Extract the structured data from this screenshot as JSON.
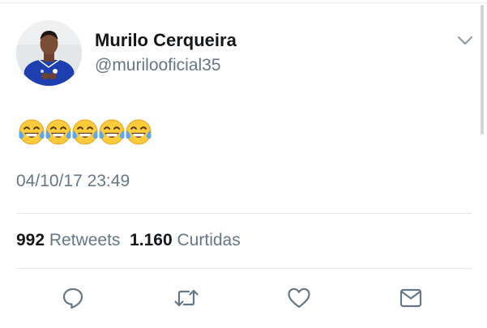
{
  "tweet": {
    "author": {
      "display_name": "Murilo Cerqueira",
      "handle": "@murilooficial35",
      "avatar_icon": "profile-photo"
    },
    "body": {
      "emoji_name": "face-with-tears-of-joy",
      "emoji_count": 5
    },
    "timestamp": "04/10/17 23:49",
    "stats": {
      "retweets_count": "992",
      "retweets_label": "Retweets",
      "likes_count": "1.160",
      "likes_label": "Curtidas"
    },
    "actions": [
      {
        "name": "reply",
        "icon": "reply-icon"
      },
      {
        "name": "retweet",
        "icon": "retweet-icon"
      },
      {
        "name": "like",
        "icon": "heart-icon"
      },
      {
        "name": "direct-message",
        "icon": "envelope-icon"
      }
    ],
    "menu_icon": "chevron-down-icon"
  },
  "colors": {
    "primary_text": "#14171a",
    "secondary_text": "#657786",
    "divider": "#e1e8ed",
    "icon": "#657786",
    "emoji_face": "#fbcb3b",
    "emoji_tear": "#5ea7e8"
  }
}
